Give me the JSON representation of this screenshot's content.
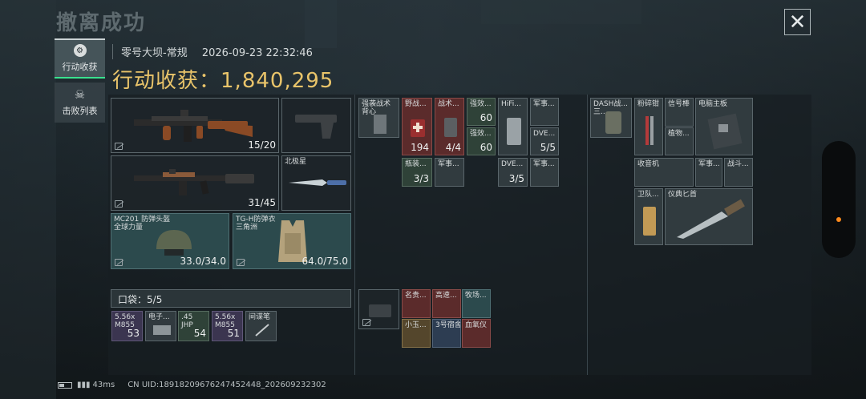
{
  "header": {
    "title": "撤离成功",
    "close_glyph": "✕"
  },
  "tabs": [
    {
      "label": "行动收获",
      "icon": "gear-icon",
      "active": true
    },
    {
      "label": "击败列表",
      "icon": "skull-icon",
      "active": false
    }
  ],
  "match": {
    "map": "零号大坝-常规",
    "datetime": "2026-09-23 22:32:46",
    "value_label": "行动收获：",
    "value": "1,840,295"
  },
  "loadout": {
    "primary": {
      "ammo": "15/20"
    },
    "pistol": {},
    "secondary": {
      "ammo": "31/45"
    },
    "melee": {
      "name": "北极星"
    },
    "helmet": {
      "name": "MC201 防弹头盔",
      "sub": "全球力量",
      "durability": "33.0/34.0"
    },
    "armor": {
      "name": "TG-H防弹衣",
      "sub": "三角洲",
      "durability": "64.0/75.0"
    }
  },
  "pocket": {
    "label": "口袋：",
    "count": "5/5",
    "items": [
      {
        "name": "5.56x",
        "sub": "M855",
        "count": "53"
      },
      {
        "name": "电子...",
        "sub": "",
        "count": ""
      },
      {
        "name": ".45",
        "sub": "JHP",
        "count": "54"
      },
      {
        "name": "5.56x",
        "sub": "M855",
        "count": "51"
      },
      {
        "name": "间谍笔",
        "sub": "",
        "count": ""
      }
    ]
  },
  "chest_rig": {
    "main_item": {
      "name": "强袭战术",
      "sub": "背心"
    },
    "items": [
      {
        "name": "野战...",
        "count": "194"
      },
      {
        "name": "战术...",
        "count": "4/4"
      },
      {
        "name": "强效...",
        "count": "60"
      },
      {
        "name": "强效...",
        "count": "60"
      },
      {
        "name": "HiFi...",
        "count": ""
      },
      {
        "name": "军事...",
        "count": ""
      },
      {
        "name": "DVE...",
        "count": "5/5"
      },
      {
        "name": "瓶装...",
        "count": "3/3"
      },
      {
        "name": "军事...",
        "count": ""
      },
      {
        "name": "DVE...",
        "count": "3/5"
      },
      {
        "name": "军事...",
        "count": ""
      }
    ]
  },
  "pouch": {
    "items": [
      {
        "name": "名贵...",
        "count": ""
      },
      {
        "name": "高速...",
        "count": ""
      },
      {
        "name": "牧场...",
        "count": ""
      },
      {
        "name": "小玉...",
        "count": ""
      },
      {
        "name": "3号宿舍...",
        "count": ""
      },
      {
        "name": "血氧仪",
        "count": ""
      }
    ]
  },
  "backpack": {
    "main_item": {
      "name": "DASH战...",
      "sub": "三..."
    },
    "items": [
      {
        "name": "粉碎钳",
        "count": ""
      },
      {
        "name": "信号棒",
        "count": ""
      },
      {
        "name": "植物...",
        "count": ""
      },
      {
        "name": "电脑主板",
        "count": ""
      },
      {
        "name": "收音机",
        "count": ""
      },
      {
        "name": "军事...",
        "count": ""
      },
      {
        "name": "战斗...",
        "count": ""
      },
      {
        "name": "卫队...",
        "count": ""
      },
      {
        "name": "仪典匕首",
        "count": ""
      }
    ]
  },
  "status": {
    "ping": "43ms",
    "uid": "CN UID:1891820967624745244​8_202609232302"
  },
  "colors": {
    "value": "#e9c46a",
    "active_tab": "#39e28e",
    "handle_dot": "#ff8a1c"
  }
}
